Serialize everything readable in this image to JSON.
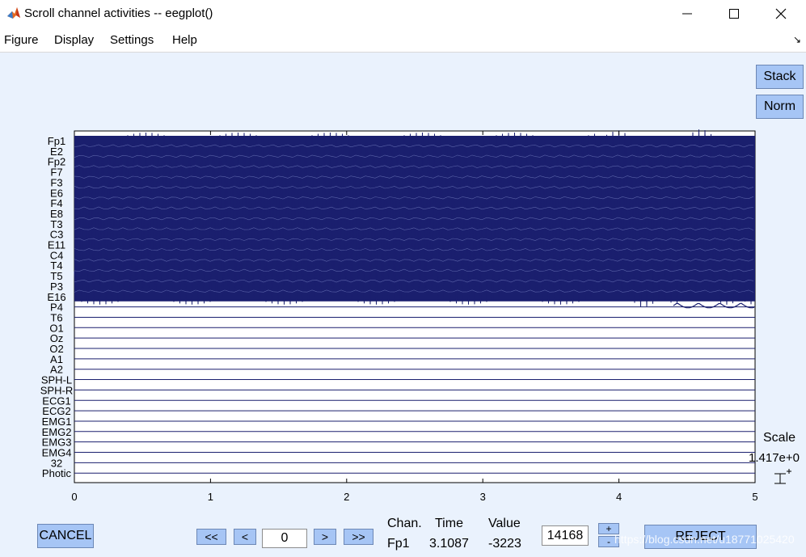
{
  "window": {
    "title": "Scroll channel activities -- eegplot()"
  },
  "menu": {
    "items": [
      "Figure",
      "Display",
      "Settings",
      "Help"
    ]
  },
  "buttons": {
    "stack": "Stack",
    "norm": "Norm",
    "cancel": "CANCEL",
    "reject": "REJECT",
    "first": "<<",
    "prev": "<",
    "next": ">",
    "last": ">>",
    "scale_plus": "+",
    "scale_minus": "-"
  },
  "scale": {
    "label": "Scale",
    "value": "1.417e+0"
  },
  "navigation": {
    "position_value": "0"
  },
  "readout": {
    "chan_label": "Chan.",
    "time_label": "Time",
    "value_label": "Value",
    "chan": "Fp1",
    "time": "3.1087",
    "value": "-3223",
    "spacing_value": "14168"
  },
  "watermark": "https://blog.csdn.net/u18771025420",
  "colors": {
    "figure_bg": "#eaf2fd",
    "button_bg": "#a6c5f5",
    "trace": "#1a1f6e",
    "axis_bg": "#ffffff"
  },
  "chart_data": {
    "type": "line",
    "xlim": [
      0,
      5
    ],
    "x_ticks": [
      "0",
      "1",
      "2",
      "3",
      "4",
      "5"
    ],
    "channels": [
      "Fp1",
      "E2",
      "Fp2",
      "F7",
      "F3",
      "E6",
      "F4",
      "E8",
      "T3",
      "C3",
      "E11",
      "C4",
      "T4",
      "T5",
      "P3",
      "E16",
      "P4",
      "T6",
      "O1",
      "Oz",
      "O2",
      "A1",
      "A2",
      "SPH-L",
      "SPH-R",
      "ECG1",
      "ECG2",
      "EMG1",
      "EMG2",
      "EMG3",
      "EMG4",
      "32",
      "Photic"
    ],
    "active_channel_count": 16,
    "grid": false
  }
}
